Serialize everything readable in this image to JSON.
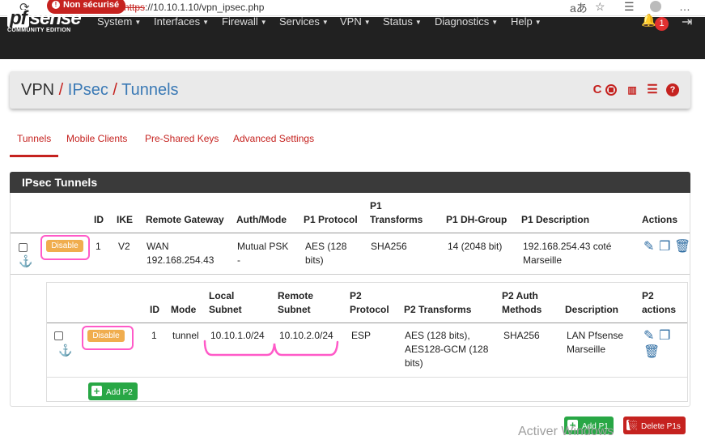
{
  "browser": {
    "security_label": "Non sécurisé",
    "url_protocol": "https",
    "url_rest": "://10.10.1.10/vpn_ipsec.php",
    "icons": [
      "refresh-icon",
      "translate-icon",
      "star-icon",
      "favorites-icon",
      "profile-icon",
      "more-icon"
    ]
  },
  "navbar": {
    "logo_main": "sense",
    "logo_pf": "pf",
    "logo_sub": "COMMUNITY EDITION",
    "menus": [
      "System",
      "Interfaces",
      "Firewall",
      "Services",
      "VPN",
      "Status",
      "Diagnostics",
      "Help"
    ],
    "notification_count": "1"
  },
  "breadcrumb": {
    "root": "VPN",
    "level1": "IPsec",
    "current": "Tunnels"
  },
  "tabs": [
    "Tunnels",
    "Mobile Clients",
    "Pre-Shared Keys",
    "Advanced Settings"
  ],
  "panel_title": "IPsec Tunnels",
  "p1": {
    "headers": {
      "id": "ID",
      "ike": "IKE",
      "gateway": "Remote Gateway",
      "auth": "Auth/Mode",
      "protocol": "P1 Protocol",
      "transforms": "P1\nTransforms",
      "dh": "P1 DH-Group",
      "desc": "P1 Description",
      "actions": "Actions"
    },
    "row": {
      "disable": "Disable",
      "id": "1",
      "ike": "V2",
      "gateway": "WAN\n192.168.254.43",
      "auth": "Mutual PSK\n-",
      "protocol": "AES (128\nbits)",
      "transforms": "SHA256",
      "dh": "14 (2048 bit)",
      "desc": "192.168.254.43 coté\nMarseille"
    }
  },
  "p2": {
    "headers": {
      "id": "ID",
      "mode": "Mode",
      "local": "Local\nSubnet",
      "remote": "Remote\nSubnet",
      "protocol": "P2\nProtocol",
      "transforms": "P2 Transforms",
      "auth": "P2 Auth\nMethods",
      "desc": "Description",
      "actions": "P2\nactions"
    },
    "row": {
      "disable": "Disable",
      "id": "1",
      "mode": "tunnel",
      "local": "10.10.1.0/24",
      "remote": "10.10.2.0/24",
      "protocol": "ESP",
      "transforms": "AES (128 bits),\nAES128-GCM (128\nbits)",
      "auth": "SHA256",
      "desc": "LAN Pfsense\nMarseille"
    },
    "add_label": "Add P2"
  },
  "footer": {
    "add_p1": "Add P1",
    "delete_p1": "Delete P1s"
  },
  "watermark": "Activer Windows",
  "colors": {
    "accent": "#c5221f",
    "link": "#3a79b5",
    "warning": "#f0ad4e",
    "success": "#28a745",
    "navbar": "#212121",
    "annotation": "#ff5ac8"
  }
}
